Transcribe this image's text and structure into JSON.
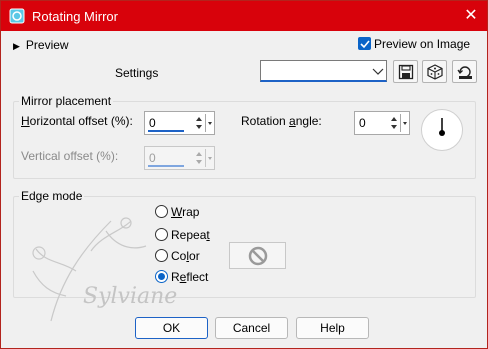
{
  "window": {
    "title": "Rotating Mirror",
    "close_glyph": "✕"
  },
  "preview_toggle": {
    "arrow": "▶",
    "label": "Preview"
  },
  "preview_on_image": {
    "label": "Preview on Image",
    "checked": true
  },
  "settings": {
    "label": "Settings",
    "combo_value": ""
  },
  "mirror_placement": {
    "title": "Mirror placement",
    "horizontal_offset_prefix": "H",
    "horizontal_offset_rest": "orizontal offset (%):",
    "horizontal_offset_value": "0",
    "rotation_prefix": "Rotation ",
    "rotation_u": "a",
    "rotation_rest": "ngle:",
    "rotation_value": "0",
    "vertical_offset_label": "Vertical offset (%):",
    "vertical_offset_value": "0"
  },
  "edge_mode": {
    "title": "Edge mode",
    "options": [
      {
        "u": "W",
        "rest": "rap",
        "selected": false
      },
      {
        "u": "",
        "pre": "Repea",
        "post_u": "t",
        "selected": false
      },
      {
        "u": "",
        "pre": "Co",
        "post_u": "l",
        "post": "or",
        "selected": false
      },
      {
        "u": "",
        "pre": "R",
        "post_u": "e",
        "post": "flect",
        "selected": true
      }
    ]
  },
  "buttons": {
    "ok": "OK",
    "cancel": "Cancel",
    "help": "Help"
  },
  "colors": {
    "titlebar": "#d8020b",
    "accent": "#0a64c8"
  }
}
